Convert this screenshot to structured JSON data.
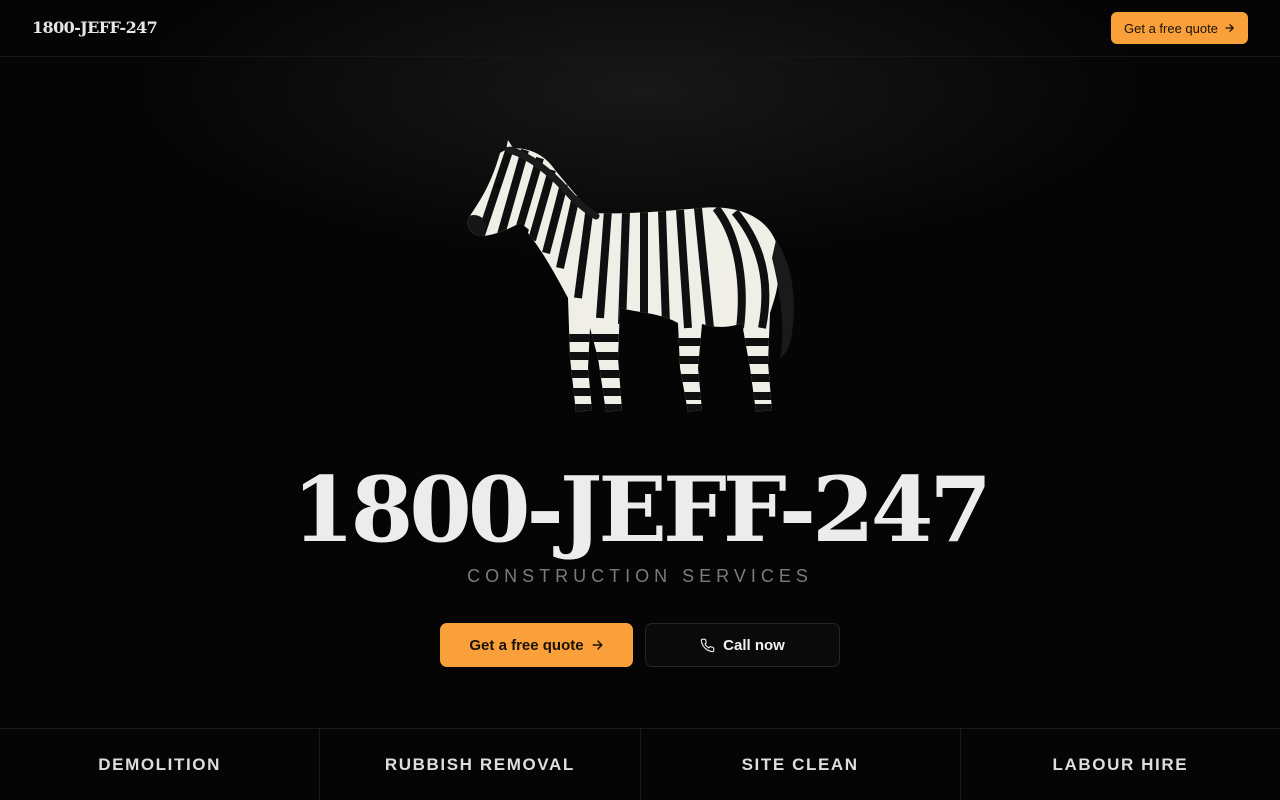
{
  "header": {
    "brand": "1800-JEFF-247",
    "cta_label": "Get a free quote"
  },
  "hero": {
    "image_icon": "zebra-icon",
    "title": "1800-JEFF-247",
    "subtitle": "CONSTRUCTION SERVICES",
    "primary_label": "Get a free quote",
    "secondary_label": "Call now",
    "secondary_icon": "phone-icon"
  },
  "services": [
    {
      "label": "DEMOLITION"
    },
    {
      "label": "RUBBISH REMOVAL"
    },
    {
      "label": "SITE CLEAN"
    },
    {
      "label": "LABOUR HIRE"
    }
  ],
  "colors": {
    "background": "#050505",
    "accent": "#f9a03a",
    "text": "#ececec",
    "muted": "#7b7b7b"
  }
}
